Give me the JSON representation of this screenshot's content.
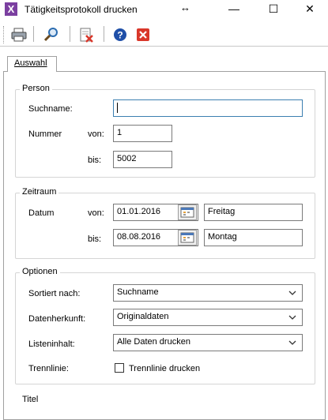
{
  "window": {
    "title": "Tätigkeitsprotokoll drucken",
    "app_icon_glyph": "X",
    "minimize_glyph": "—",
    "maximize_glyph": "☐",
    "close_glyph": "✕",
    "resize_glyph": "↔"
  },
  "toolbar": {
    "icons": [
      "printer-icon",
      "search-icon",
      "export-icon",
      "help-icon",
      "close-icon"
    ],
    "help_glyph": "?",
    "close_glyph": "✕"
  },
  "tabs": [
    {
      "label": "Auswahl"
    }
  ],
  "person": {
    "title": "Person",
    "suchname_label": "Suchname:",
    "suchname_value": "",
    "nummer_label": "Nummer",
    "von_label": "von:",
    "von_value": "1",
    "bis_label": "bis:",
    "bis_value": "5002"
  },
  "zeitraum": {
    "title": "Zeitraum",
    "datum_label": "Datum",
    "von_label": "von:",
    "von_value": "01.01.2016",
    "von_day": "Freitag",
    "bis_label": "bis:",
    "bis_value": "08.08.2016",
    "bis_day": "Montag"
  },
  "optionen": {
    "title": "Optionen",
    "sortiert_label": "Sortiert nach:",
    "sortiert_value": "Suchname",
    "herkunft_label": "Datenherkunft:",
    "herkunft_value": "Originaldaten",
    "inhalt_label": "Listeninhalt:",
    "inhalt_value": "Alle Daten drucken",
    "trennlinie_label": "Trennlinie:",
    "trennlinie_checkbox_label": "Trennlinie drucken",
    "trennlinie_checked": false
  },
  "next_group_title_partial": "Titel",
  "colors": {
    "accent_border": "#3c7fb1",
    "app_icon": "#7b3fa0",
    "close_red": "#d9372a",
    "help_blue": "#1f4fa8"
  }
}
